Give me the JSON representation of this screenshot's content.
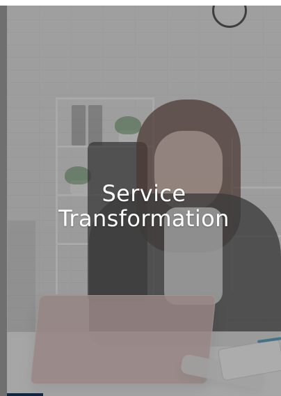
{
  "card": {
    "title_line_1": "Service",
    "title_line_2": "Transformation"
  }
}
